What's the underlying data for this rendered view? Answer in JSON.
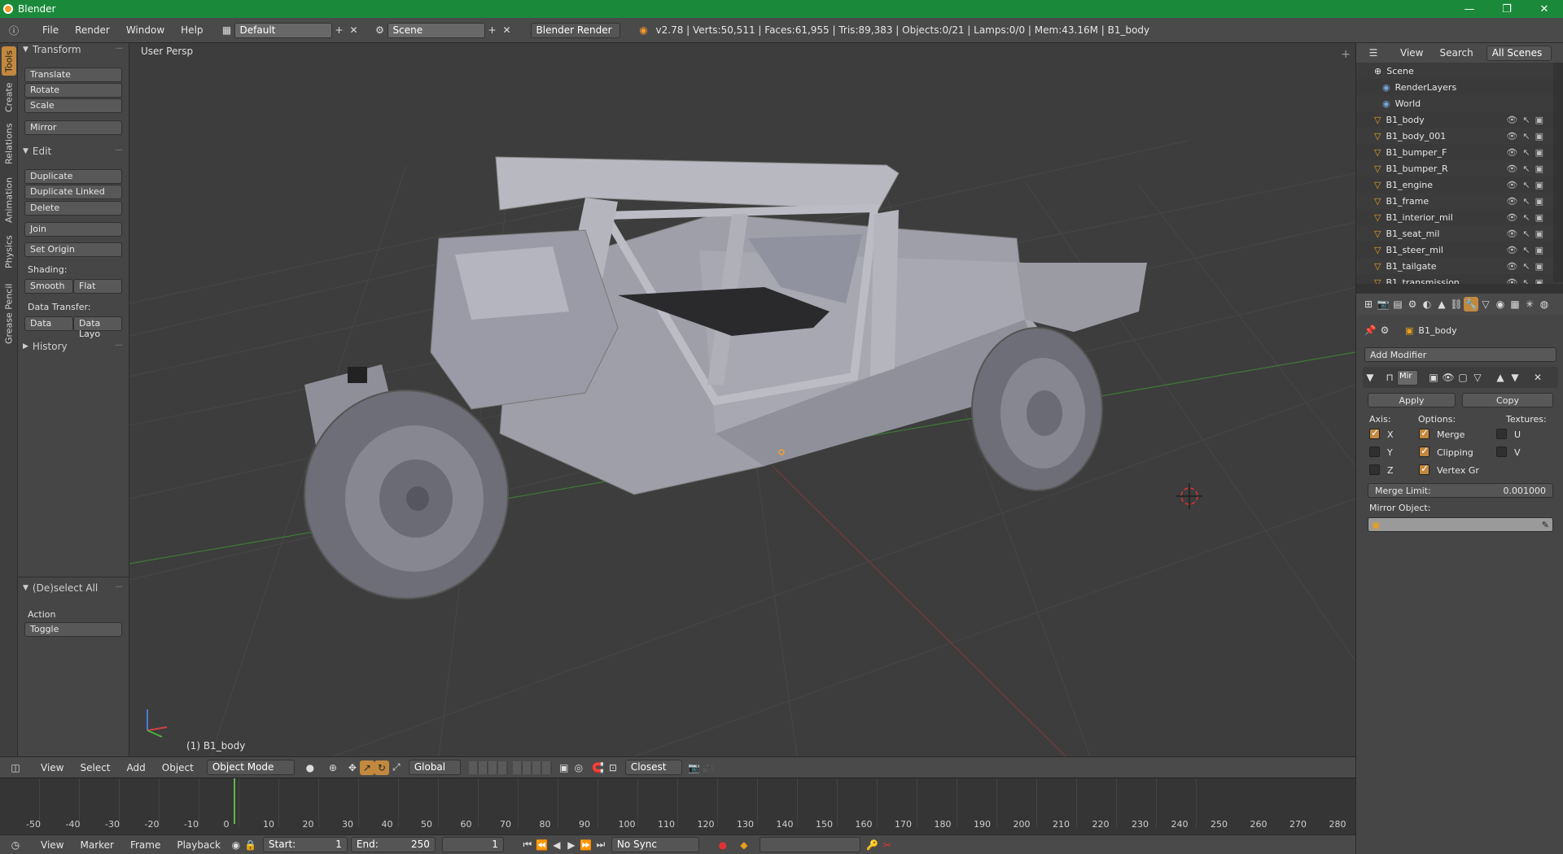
{
  "window": {
    "title": "Blender",
    "controls": [
      "—",
      "❐",
      "✕"
    ]
  },
  "infobar": {
    "menus": [
      "File",
      "Render",
      "Window",
      "Help"
    ],
    "layout_name": "Default",
    "scene_name": "Scene",
    "render_engine": "Blender Render",
    "stats": "v2.78 | Verts:50,511 | Faces:61,955 | Tris:89,383 | Objects:0/21 | Lamps:0/0 | Mem:43.16M | B1_body"
  },
  "vtabs": [
    "Tools",
    "Create",
    "Relations",
    "Animation",
    "Physics",
    "Grease Pencil"
  ],
  "toolshelf": {
    "transform": {
      "header": "Transform",
      "buttons": [
        "Translate",
        "Rotate",
        "Scale",
        "Mirror"
      ]
    },
    "edit": {
      "header": "Edit",
      "buttons": [
        "Duplicate",
        "Duplicate Linked",
        "Delete",
        "Join",
        "Set Origin"
      ]
    },
    "shading": {
      "label": "Shading:",
      "smooth": "Smooth",
      "flat": "Flat"
    },
    "data_transfer": {
      "label": "Data Transfer:",
      "data": "Data",
      "data_layo": "Data Layo"
    },
    "history": "History",
    "deselect": {
      "header": "(De)select All",
      "action_label": "Action",
      "action_value": "Toggle"
    }
  },
  "viewport": {
    "view_label": "User Persp",
    "object_label": "(1) B1_body"
  },
  "view3d_header": {
    "menus": [
      "View",
      "Select",
      "Add",
      "Object"
    ],
    "mode": "Object Mode",
    "orientation": "Global",
    "snap": "Closest"
  },
  "timeline": {
    "ticks": [
      "-50",
      "-40",
      "-30",
      "-20",
      "-10",
      "0",
      "10",
      "20",
      "30",
      "40",
      "50",
      "60",
      "70",
      "80",
      "90",
      "100",
      "110",
      "120",
      "130",
      "140",
      "150",
      "160",
      "170",
      "180",
      "190",
      "200",
      "210",
      "220",
      "230",
      "240",
      "250",
      "260",
      "270",
      "280"
    ],
    "current_frame": 1
  },
  "timeline_header": {
    "menus": [
      "View",
      "Marker",
      "Frame",
      "Playback"
    ],
    "start_label": "Start:",
    "start_value": "1",
    "end_label": "End:",
    "end_value": "250",
    "current": "1",
    "sync": "No Sync"
  },
  "outliner": {
    "menus": [
      "View",
      "Search"
    ],
    "scenes": "All Scenes",
    "scene": "Scene",
    "items": [
      "RenderLayers",
      "World",
      "B1_body",
      "B1_body_001",
      "B1_bumper_F",
      "B1_bumper_R",
      "B1_engine",
      "B1_frame",
      "B1_interior_mil",
      "B1_seat_mil",
      "B1_steer_mil",
      "B1_tailgate",
      "B1_transmission"
    ]
  },
  "properties": {
    "object_name": "B1_body",
    "add_modifier": "Add Modifier",
    "modifier_name": "Mir",
    "apply": "Apply",
    "copy": "Copy",
    "axis_label": "Axis:",
    "options_label": "Options:",
    "textures_label": "Textures:",
    "axes": [
      "X",
      "Y",
      "Z"
    ],
    "options": [
      "Merge",
      "Clipping",
      "Vertex Gr"
    ],
    "textures": [
      "U",
      "V"
    ],
    "merge_limit_label": "Merge Limit:",
    "merge_limit_value": "0.001000",
    "mirror_object_label": "Mirror Object:"
  }
}
